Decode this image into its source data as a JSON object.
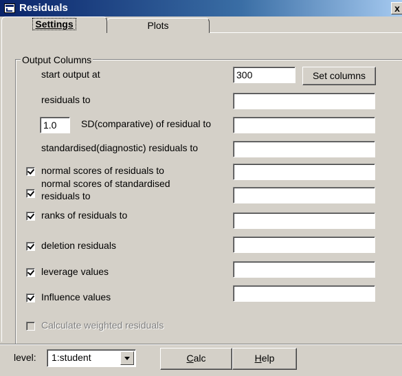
{
  "window": {
    "title": "Residuals",
    "close_label": "x"
  },
  "tabs": [
    {
      "label": "Settings",
      "active": true
    },
    {
      "label": "Plots",
      "active": false
    }
  ],
  "output_columns": {
    "group_label": "Output Columns",
    "start_output_label": "start output at",
    "start_output_value": "300",
    "set_columns_label": "Set columns",
    "residuals_label": "residuals to",
    "residuals_value": "",
    "sd_multiplier_value": "1.0",
    "sd_label": "SD(comparative) of residual to",
    "sd_value": "",
    "standardised_label": "standardised(diagnostic) residuals to",
    "standardised_value": "",
    "normal_scores": {
      "label": "normal scores of residuals to",
      "checked": true,
      "value": ""
    },
    "normal_scores_std": {
      "label_line1": "normal scores of standardised",
      "label_line2": "residuals to",
      "checked": true,
      "value": ""
    },
    "ranks": {
      "label": "ranks of residuals to",
      "checked": true,
      "value": ""
    },
    "deletion": {
      "label": "deletion residuals",
      "checked": true,
      "value": ""
    },
    "leverage": {
      "label": "leverage values",
      "checked": true,
      "value": ""
    },
    "influence": {
      "label": "Influence values",
      "checked": true,
      "value": ""
    },
    "weighted": {
      "label": "Calculate weighted residuals",
      "checked": false,
      "enabled": false
    }
  },
  "footer": {
    "level_label": "level:",
    "level_value": "1:student",
    "calc_label": "alc",
    "calc_accel": "C",
    "help_label": "elp",
    "help_accel": "H"
  }
}
